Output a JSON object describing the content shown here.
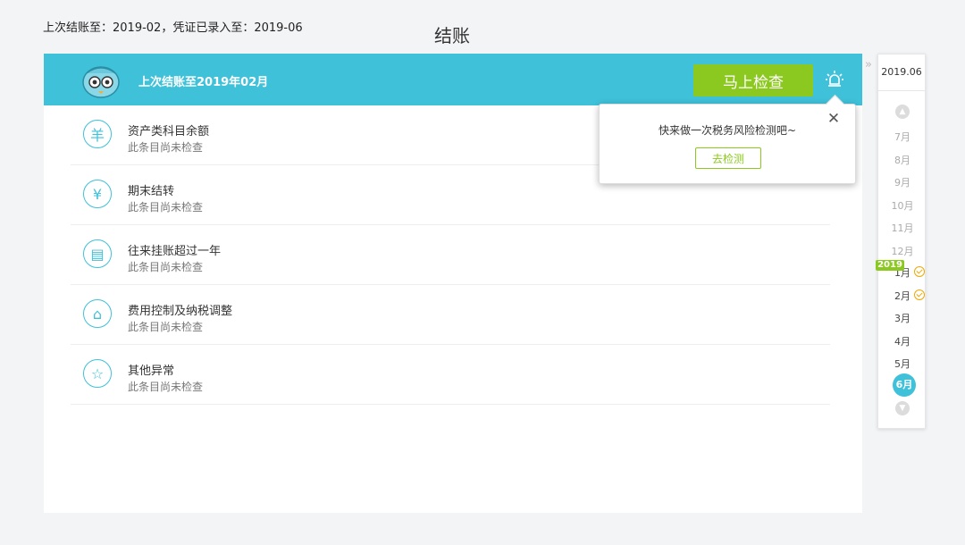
{
  "top_info": "上次结账至：2019-02，凭证已录入至：2019-06",
  "page_title": "结账",
  "header": {
    "status_text": "上次结账至2019年02月",
    "check_button": "马上检查"
  },
  "items": [
    {
      "icon": "yang-icon",
      "symbol": "羊",
      "title": "资产类科目余额",
      "status": "此条目尚未检查"
    },
    {
      "icon": "yen-icon",
      "symbol": "¥",
      "title": "期末结转",
      "status": "此条目尚未检查"
    },
    {
      "icon": "document-icon",
      "symbol": "▤",
      "title": "往来挂账超过一年",
      "status": "此条目尚未检查"
    },
    {
      "icon": "receipt-icon",
      "symbol": "⌂",
      "title": "费用控制及纳税调整",
      "status": "此条目尚未检查"
    },
    {
      "icon": "star-icon",
      "symbol": "☆",
      "title": "其他异常",
      "status": "此条目尚未检查"
    }
  ],
  "popup": {
    "message": "快来做一次税务风险检测吧~",
    "button": "去检测"
  },
  "timeline": {
    "current": "2019.06",
    "year_badge": "2019",
    "months_before": [
      "7月",
      "8月",
      "9月",
      "10月",
      "11月",
      "12月"
    ],
    "months_after": [
      "1月",
      "2月",
      "3月",
      "4月",
      "5月",
      "6月"
    ],
    "checked_months": [
      "1月",
      "2月"
    ],
    "selected": "6月"
  },
  "colors": {
    "accent": "#3fc1d9",
    "green": "#8cc920",
    "check_mark": "#f0a800"
  }
}
